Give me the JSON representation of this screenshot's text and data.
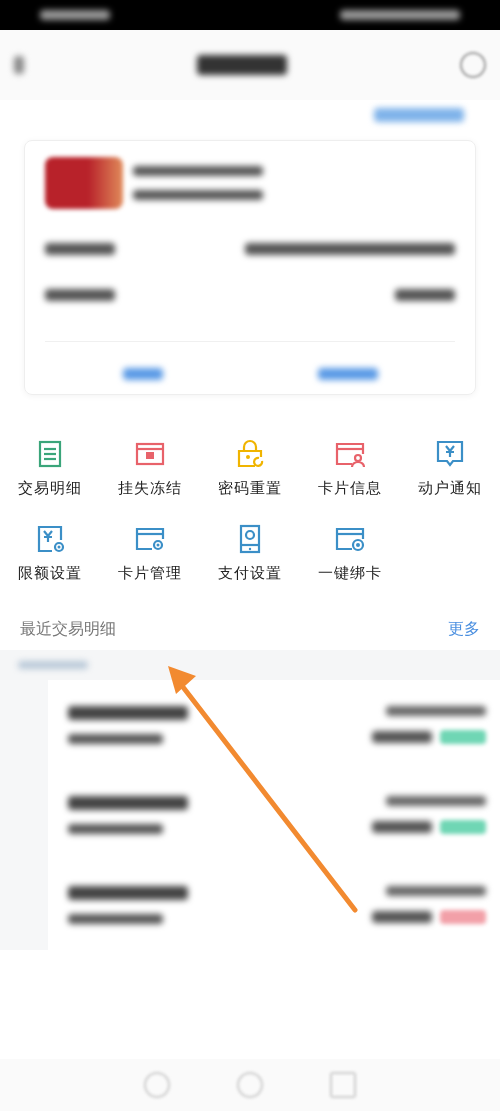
{
  "actions": [
    {
      "label": "交易明细",
      "color": "#3aa57a"
    },
    {
      "label": "挂失冻结",
      "color": "#e8626a"
    },
    {
      "label": "密码重置",
      "color": "#f0b400"
    },
    {
      "label": "卡片信息",
      "color": "#e8626a"
    },
    {
      "label": "动户通知",
      "color": "#3b8fc7"
    },
    {
      "label": "限额设置",
      "color": "#3b8fc7"
    },
    {
      "label": "卡片管理",
      "color": "#3b8fc7"
    },
    {
      "label": "支付设置",
      "color": "#3b8fc7"
    },
    {
      "label": "一键绑卡",
      "color": "#3b8fc7"
    }
  ],
  "recent": {
    "title": "最近交易明细",
    "more": "更多"
  },
  "transactions": [
    {
      "color": "#6fd6b4"
    },
    {
      "color": "#6fd6b4"
    },
    {
      "color": "#f2a0a8"
    }
  ]
}
